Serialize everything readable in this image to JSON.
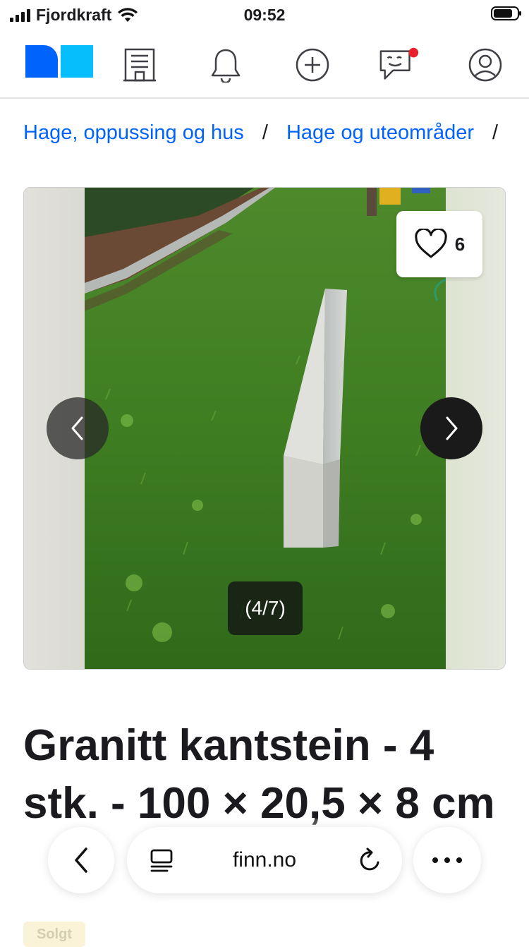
{
  "status_bar": {
    "carrier": "Fjordkraft",
    "time": "09:52"
  },
  "nav": {
    "icons": [
      "finn-logo",
      "building-icon",
      "bell-icon",
      "plus-circle-icon",
      "chat-icon",
      "profile-icon"
    ],
    "has_chat_notification": true
  },
  "breadcrumb": {
    "items": [
      "Hage, oppussing og hus",
      "Hage og uteområder"
    ],
    "separator": "/"
  },
  "gallery": {
    "favorite_count": "6",
    "counter": "(4/7)"
  },
  "listing": {
    "title": "Granitt kantstein - 4 stk. - 100 × 20,5 × 8 cm",
    "badge": "Solgt"
  },
  "browser": {
    "url": "finn.no"
  },
  "colors": {
    "link": "#0063fb",
    "logo_dark": "#0063fb",
    "logo_light": "#06befb",
    "notification": "#e8202a"
  }
}
